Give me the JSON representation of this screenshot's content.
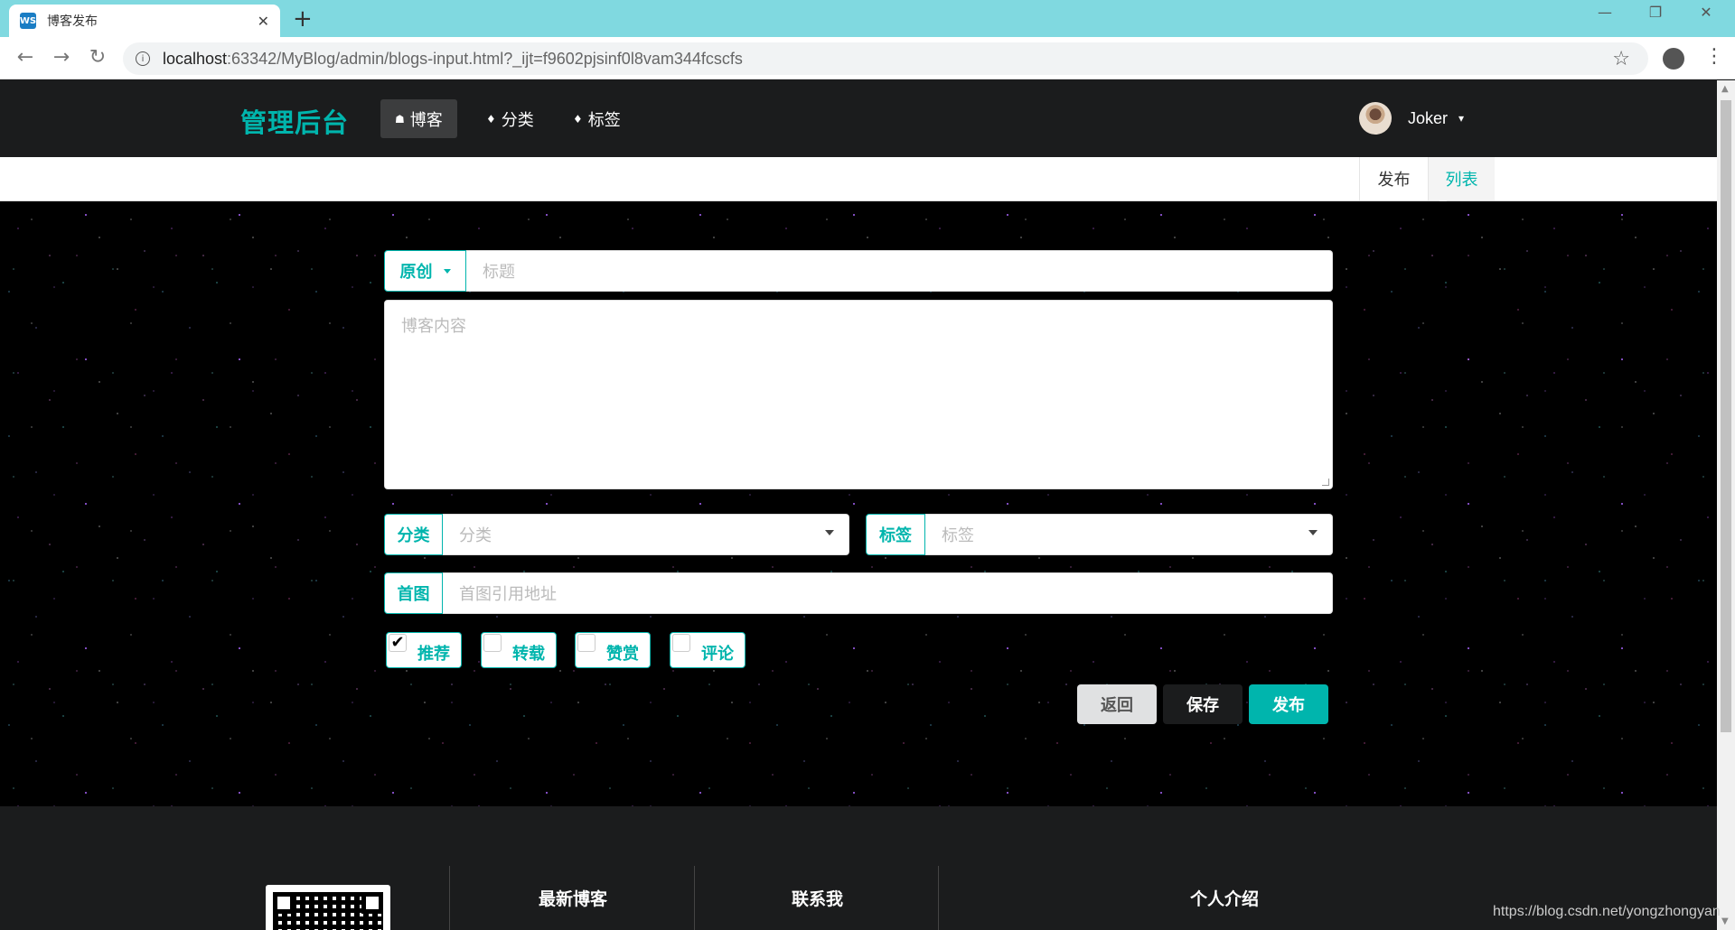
{
  "browser": {
    "tab_title": "博客发布",
    "favicon_text": "WS",
    "close_glyph": "✕",
    "new_tab_glyph": "+",
    "url_host": "localhost",
    "url_rest": ":63342/MyBlog/admin/blogs-input.html?_ijt=f9602pjsinf0l8vam344fcscfs",
    "back_glyph": "←",
    "forward_glyph": "→",
    "reload_glyph": "↻",
    "minimize_glyph": "—",
    "restore_glyph": "❐",
    "window_close_glyph": "✕",
    "star_glyph": "☆",
    "menu_glyph": "⋮",
    "info_glyph": "i"
  },
  "header": {
    "brand": "管理后台",
    "nav": [
      {
        "label": "博客",
        "icon": "home-icon",
        "glyph": "☗"
      },
      {
        "label": "分类",
        "icon": "idea-icon",
        "glyph": "♦"
      },
      {
        "label": "标签",
        "icon": "tags-icon",
        "glyph": "♦"
      }
    ],
    "user": {
      "name": "Joker",
      "caret": "▾"
    }
  },
  "sub_menu": {
    "publish": "发布",
    "list": "列表"
  },
  "form": {
    "type_label": "原创",
    "title_placeholder": "标题",
    "content_placeholder": "博客内容",
    "category_label": "分类",
    "category_placeholder": "分类",
    "tag_label": "标签",
    "tag_placeholder": "标签",
    "cover_label": "首图",
    "cover_placeholder": "首图引用地址",
    "checkboxes": [
      {
        "label": "推荐",
        "checked": true,
        "mark": "✔"
      },
      {
        "label": "转载",
        "checked": false,
        "mark": ""
      },
      {
        "label": "赞赏",
        "checked": false,
        "mark": ""
      },
      {
        "label": "评论",
        "checked": false,
        "mark": ""
      }
    ],
    "buttons": {
      "back": "返回",
      "save": "保存",
      "publish": "发布"
    }
  },
  "footer": {
    "latest": "最新博客",
    "contact": "联系我",
    "about": "个人介绍"
  },
  "watermark": "https://blog.csdn.net/yongzhongyan",
  "colors": {
    "accent": "#00b5ad",
    "menu_bg": "#1b1c1d",
    "tabbar": "#80d9e0"
  }
}
